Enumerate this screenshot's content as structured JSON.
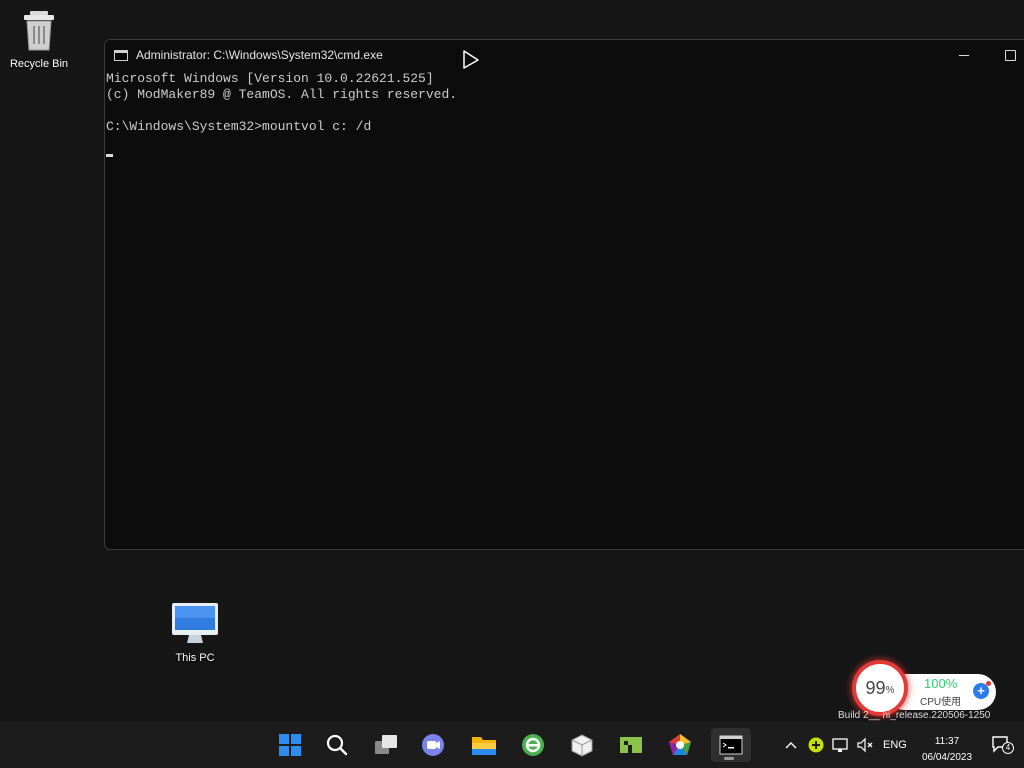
{
  "desktop": {
    "icons": [
      {
        "label": "Recycle Bin"
      },
      {
        "label": "This PC"
      }
    ]
  },
  "cmd_window": {
    "title": "Administrator: C:\\Windows\\System32\\cmd.exe",
    "lines": [
      "Microsoft Windows [Version 10.0.22621.525]",
      "(c) ModMaker89 @ TeamOS. All rights reserved.",
      "",
      "C:\\Windows\\System32>mountvol c: /d"
    ]
  },
  "cpu_widget": {
    "memory_percent": "99",
    "percent_sign": "%",
    "cpu_percent": "100%",
    "cpu_label": "CPU使用",
    "accent_ring": "#e53935",
    "value_color": "#2ecc71"
  },
  "watermark": "Build 2__ ni_release.220506-1250",
  "taskbar": {
    "icons": [
      {
        "name": "start-icon"
      },
      {
        "name": "search-icon"
      },
      {
        "name": "task-view-icon"
      },
      {
        "name": "teams-chat-icon"
      },
      {
        "name": "file-explorer-icon"
      },
      {
        "name": "browser-icon"
      },
      {
        "name": "package-icon"
      },
      {
        "name": "green-app-icon"
      },
      {
        "name": "colorful-app-icon"
      },
      {
        "name": "cmd-icon"
      }
    ],
    "tray": {
      "language": "ENG",
      "time": "11:37",
      "date": "06/04/2023",
      "notification_count": "4"
    }
  }
}
